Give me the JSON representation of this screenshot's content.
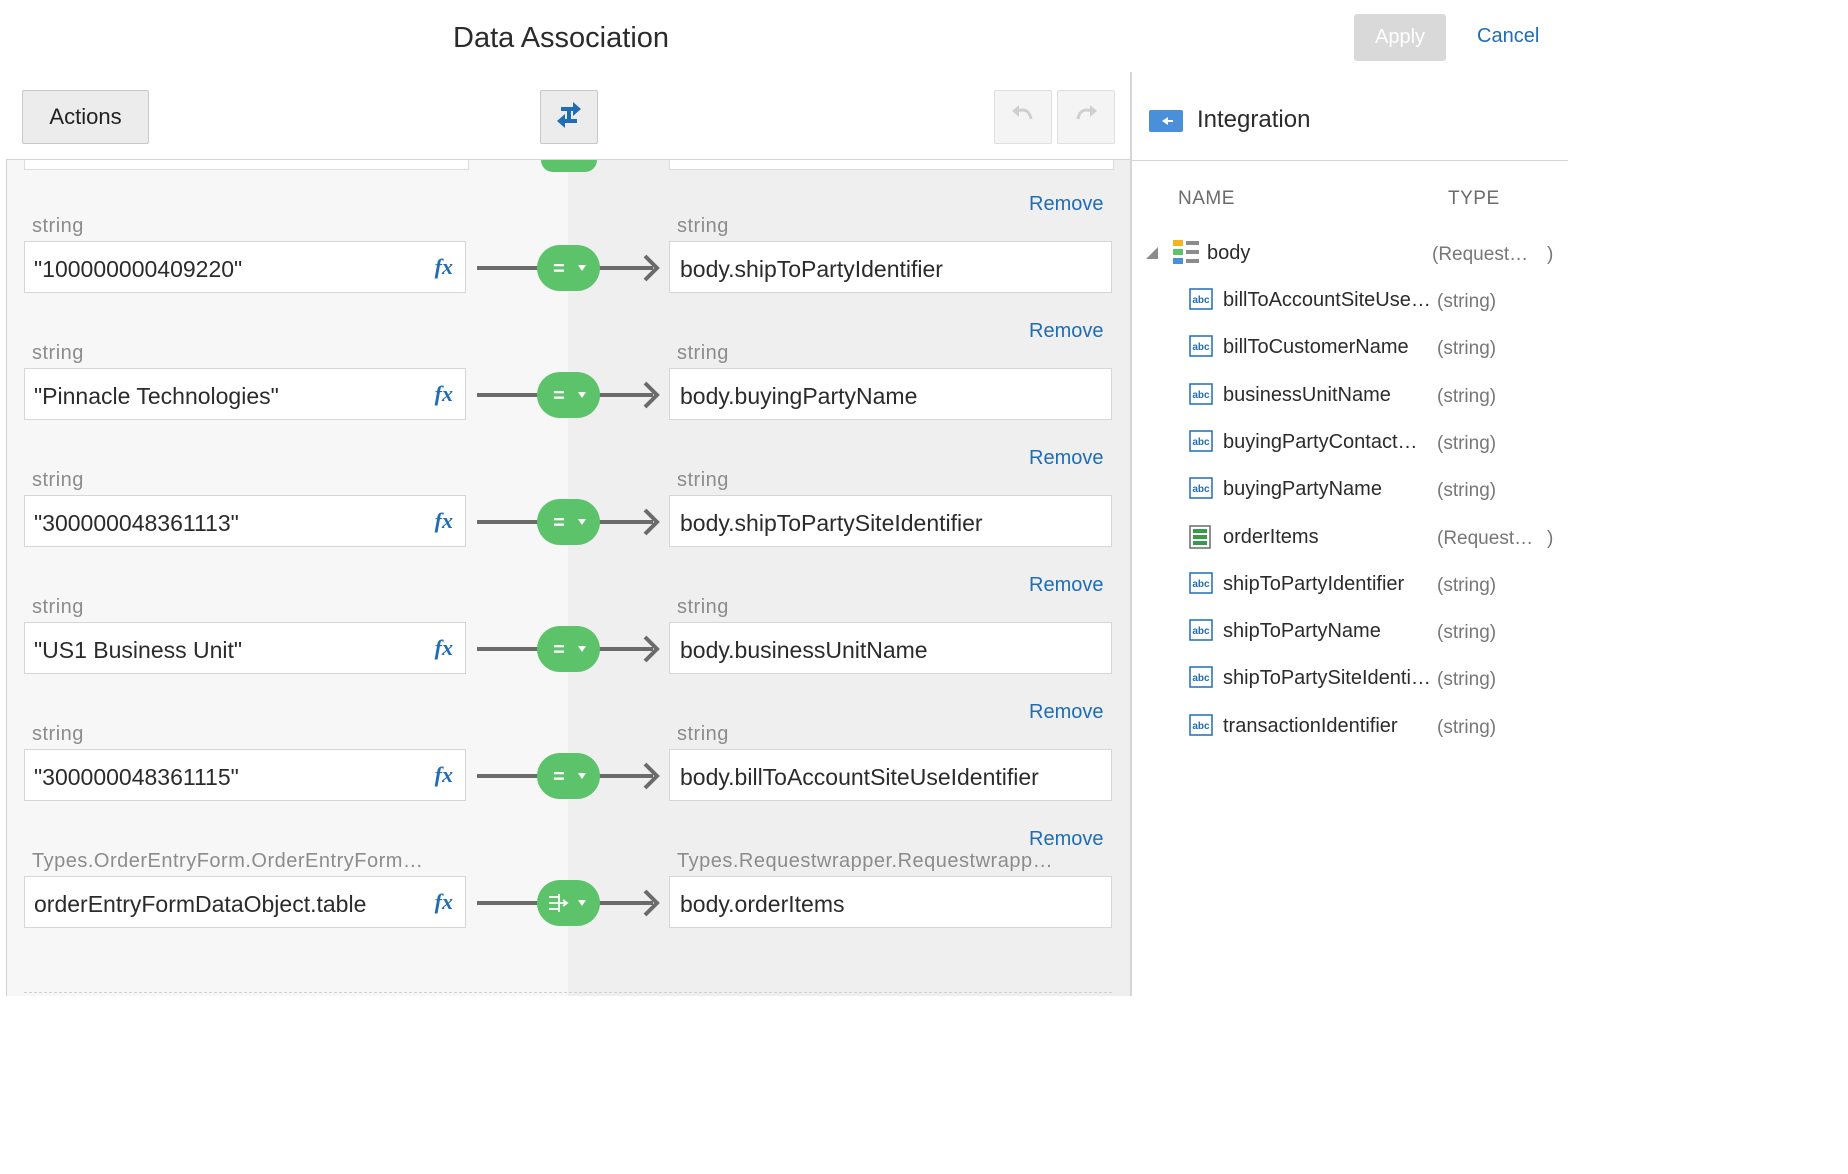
{
  "header": {
    "title": "Data Association",
    "apply_label": "Apply",
    "cancel_label": "Cancel"
  },
  "toolbar": {
    "actions_label": "Actions",
    "automap_icon": "automap-icon",
    "undo_icon": "undo-icon",
    "redo_icon": "redo-icon"
  },
  "mappings": [
    {
      "remove": "Remove",
      "src_type": "string",
      "src_value": "\"100000000409220\"",
      "dst_type": "string",
      "dst_value": "body.shipToPartyIdentifier",
      "op": "="
    },
    {
      "remove": "Remove",
      "src_type": "string",
      "src_value": "\"Pinnacle Technologies\"",
      "dst_type": "string",
      "dst_value": "body.buyingPartyName",
      "op": "="
    },
    {
      "remove": "Remove",
      "src_type": "string",
      "src_value": "\"300000048361113\"",
      "dst_type": "string",
      "dst_value": "body.shipToPartySiteIdentifier",
      "op": "="
    },
    {
      "remove": "Remove",
      "src_type": "string",
      "src_value": "\"US1 Business Unit\"",
      "dst_type": "string",
      "dst_value": "body.businessUnitName",
      "op": "="
    },
    {
      "remove": "Remove",
      "src_type": "string",
      "src_value": "\"300000048361115\"",
      "dst_type": "string",
      "dst_value": "body.billToAccountSiteUseIdentifier",
      "op": "="
    },
    {
      "remove": "Remove",
      "src_type": "Types.OrderEntryForm.OrderEntryForm…",
      "src_value": "orderEntryFormDataObject.table",
      "dst_type": "Types.Requestwrapper.Requestwrapp…",
      "dst_value": "body.orderItems",
      "op": "for-each"
    }
  ],
  "fx_label": "fx",
  "integration": {
    "title": "Integration",
    "col_name": "NAME",
    "col_type": "TYPE",
    "root": {
      "name": "body",
      "type": "(Request…",
      "paren": ")"
    },
    "items": [
      {
        "name": "billToAccountSiteUse…",
        "type": "(string)",
        "icon": "string-icon"
      },
      {
        "name": "billToCustomerName",
        "type": "(string)",
        "icon": "string-icon"
      },
      {
        "name": "businessUnitName",
        "type": "(string)",
        "icon": "string-icon"
      },
      {
        "name": "buyingPartyContact…",
        "type": "(string)",
        "icon": "string-icon"
      },
      {
        "name": "buyingPartyName",
        "type": "(string)",
        "icon": "string-icon"
      },
      {
        "name": "orderItems",
        "type": "(Request…",
        "paren": ")",
        "icon": "table-icon"
      },
      {
        "name": "shipToPartyIdentifier",
        "type": "(string)",
        "icon": "string-icon"
      },
      {
        "name": "shipToPartyName",
        "type": "(string)",
        "icon": "string-icon"
      },
      {
        "name": "shipToPartySiteIdenti…",
        "type": "(string)",
        "icon": "string-icon"
      },
      {
        "name": "transactionIdentifier",
        "type": "(string)",
        "icon": "string-icon"
      }
    ]
  },
  "colors": {
    "accent": "#1f6db5",
    "operator_green": "#5cc36b",
    "arrow": "#6b6b6b"
  }
}
